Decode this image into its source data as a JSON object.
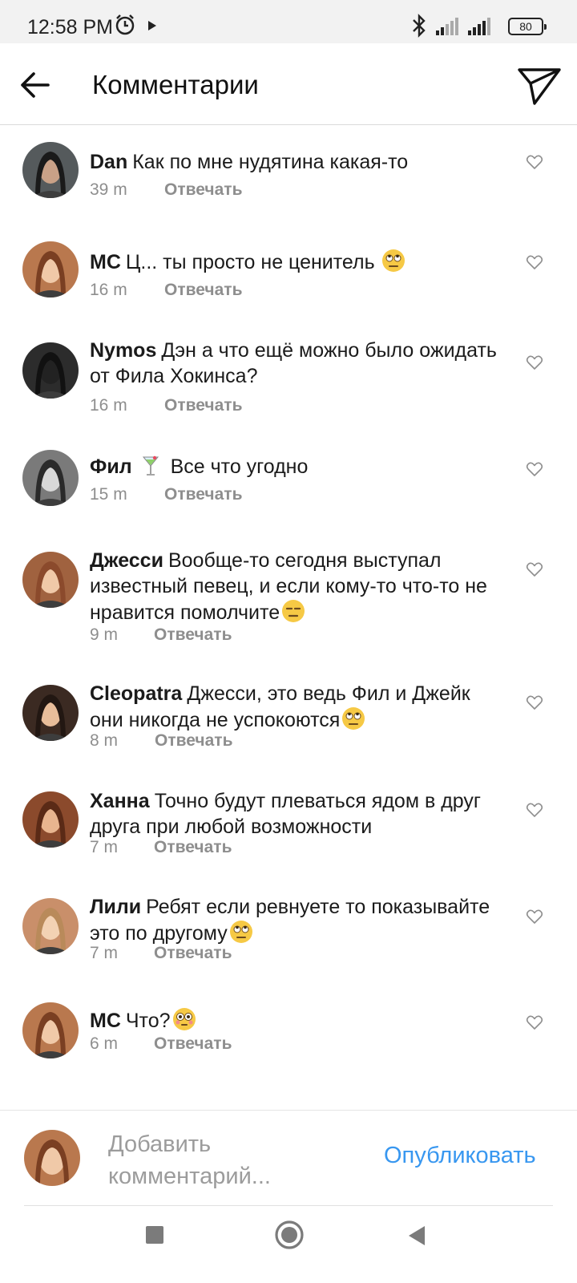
{
  "status_bar": {
    "time": "12:58 PM",
    "battery": "80",
    "icons": [
      "alarm-icon",
      "play-icon",
      "bluetooth-icon",
      "signal-icon",
      "signal-icon",
      "battery-icon"
    ]
  },
  "header": {
    "title": "Комментарии",
    "back_icon": "arrow-left-icon",
    "share_icon": "paper-plane-icon"
  },
  "comments": [
    {
      "user": "Dan",
      "text": "Как по мне нудятина какая-то",
      "time": "39 m",
      "reply": "Отвечать",
      "emoji": "",
      "avatar_color": "#555a5c"
    },
    {
      "user": "MC",
      "text": "Ц... ты просто не ценитель",
      "time": "16 m",
      "reply": "Отвечать",
      "emoji": "rolling-eyes-emoji",
      "avatar_color": "#b9784e"
    },
    {
      "user": "Nymos",
      "text": "Дэн а что ещё можно было ожидать от Фила Хокинса?",
      "time": "16 m",
      "reply": "Отвечать",
      "emoji": "",
      "avatar_color": "#2c2c2c"
    },
    {
      "user": "Фил",
      "text": "Все что угодно",
      "time": "15 m",
      "reply": "Отвечать",
      "emoji": "cocktail-emoji",
      "avatar_color": "#7a7a7a"
    },
    {
      "user": "Джесси",
      "text": "Вообще-то сегодня выступал известный певец, и если кому-то что-то не нравится помолчите",
      "time": "9 m",
      "reply": "Отвечать",
      "emoji": "expressionless-emoji",
      "avatar_color": "#a0623f"
    },
    {
      "user": "Cleopatra",
      "text": "Джесси, это ведь Фил и Джейк они никогда не успокоются",
      "time": "8 m",
      "reply": "Отвечать",
      "emoji": "rolling-eyes-emoji",
      "avatar_color": "#3b2a22"
    },
    {
      "user": "Ханна",
      "text": "Точно будут плеваться ядом в друг друга при любой возможности",
      "time": "7 m",
      "reply": "Отвечать",
      "emoji": "",
      "avatar_color": "#8b4a2c"
    },
    {
      "user": "Лили",
      "text": "Ребят если ревнуете то показывайте это по другому",
      "time": "7 m",
      "reply": "Отвечать",
      "emoji": "rolling-eyes-emoji",
      "avatar_color": "#c98f6a"
    },
    {
      "user": "MC",
      "text": "Что?",
      "time": "6 m",
      "reply": "Отвечать",
      "emoji": "flushed-emoji",
      "avatar_color": "#b9784e"
    }
  ],
  "composer": {
    "placeholder": "Добавить комментарий...",
    "publish": "Опубликовать"
  },
  "nav_bar": {
    "icons": [
      "square-icon",
      "circle-home-icon",
      "triangle-back-icon"
    ]
  },
  "colors": {
    "accent": "#3897f0",
    "muted": "#8e8e8e",
    "statusbar_bg": "#f2f2f2"
  }
}
